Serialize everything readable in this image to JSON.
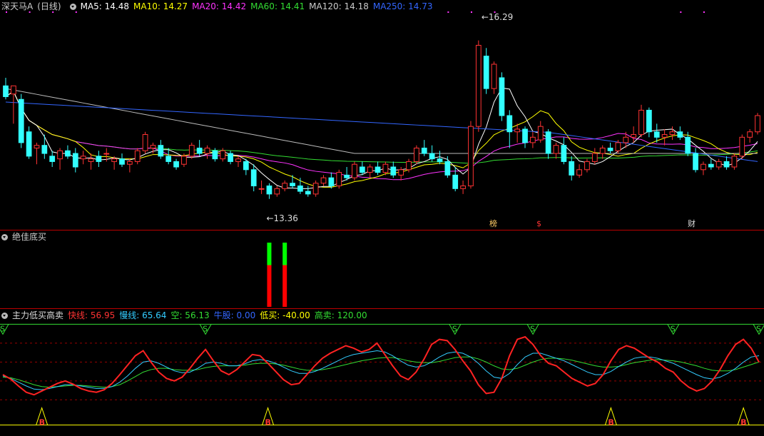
{
  "main_header": {
    "title": "深天马A",
    "period": "(日线)",
    "ma": [
      {
        "label": "MA5:",
        "value": "14.48",
        "color": "#ffffff"
      },
      {
        "label": "MA10:",
        "value": "14.27",
        "color": "#ffff00"
      },
      {
        "label": "MA20:",
        "value": "14.42",
        "color": "#ff33ff"
      },
      {
        "label": "MA60:",
        "value": "14.41",
        "color": "#33dd33"
      },
      {
        "label": "MA120:",
        "value": "14.18",
        "color": "#cccccc"
      },
      {
        "label": "MA250:",
        "value": "14.73",
        "color": "#3366ff"
      }
    ]
  },
  "panel2_header": {
    "title": "绝佳底买"
  },
  "panel3_header": {
    "title": "主力低买高卖",
    "items": [
      {
        "label": "快线:",
        "value": "56.95",
        "color": "#ff3333"
      },
      {
        "label": "慢线:",
        "value": "65.64",
        "color": "#33ccff"
      },
      {
        "label": "空:",
        "value": "56.13",
        "color": "#33dd33"
      },
      {
        "label": "牛股:",
        "value": "0.00",
        "color": "#3366ff"
      },
      {
        "label": "低买:",
        "value": "-40.00",
        "color": "#ffff00"
      },
      {
        "label": "高卖:",
        "value": "120.00",
        "color": "#33dd33"
      }
    ]
  },
  "annotations": {
    "high": "16.29",
    "low": "13.36",
    "tag1": "榜",
    "tag2": "$",
    "tag3": "财"
  },
  "signals": {
    "sell": "S",
    "buy": "B"
  },
  "chart_data": {
    "type": "candlestick",
    "ylim": [
      13.0,
      16.8
    ],
    "candles": [
      [
        15.45,
        15.6,
        15.2,
        15.25
      ],
      [
        15.3,
        15.45,
        14.75,
        15.45
      ],
      [
        15.2,
        15.3,
        14.3,
        14.4
      ],
      [
        14.6,
        14.7,
        14.1,
        14.15
      ],
      [
        14.3,
        14.4,
        14.0,
        14.35
      ],
      [
        14.35,
        14.55,
        14.1,
        14.2
      ],
      [
        14.15,
        14.25,
        13.95,
        14.05
      ],
      [
        14.1,
        14.3,
        13.9,
        14.25
      ],
      [
        14.25,
        14.35,
        14.1,
        14.15
      ],
      [
        14.2,
        14.3,
        13.85,
        13.95
      ],
      [
        14.1,
        14.25,
        14.0,
        14.15
      ],
      [
        14.05,
        14.2,
        13.9,
        14.1
      ],
      [
        14.15,
        14.25,
        13.95,
        14.05
      ],
      [
        14.2,
        14.3,
        14.05,
        14.2
      ],
      [
        14.05,
        14.15,
        13.9,
        14.1
      ],
      [
        14.1,
        14.2,
        13.95,
        14.0
      ],
      [
        14.0,
        14.1,
        13.85,
        14.05
      ],
      [
        14.05,
        14.3,
        14.0,
        14.25
      ],
      [
        14.25,
        14.6,
        14.2,
        14.55
      ],
      [
        14.3,
        14.4,
        14.2,
        14.35
      ],
      [
        14.35,
        14.45,
        14.1,
        14.15
      ],
      [
        14.15,
        14.3,
        14.0,
        14.05
      ],
      [
        14.05,
        14.1,
        13.9,
        13.95
      ],
      [
        14.0,
        14.2,
        13.95,
        14.15
      ],
      [
        14.15,
        14.4,
        14.1,
        14.35
      ],
      [
        14.3,
        14.45,
        14.15,
        14.2
      ],
      [
        14.2,
        14.35,
        14.1,
        14.3
      ],
      [
        14.25,
        14.3,
        14.05,
        14.1
      ],
      [
        14.1,
        14.3,
        14.05,
        14.25
      ],
      [
        14.2,
        14.25,
        14.0,
        14.05
      ],
      [
        14.05,
        14.15,
        13.95,
        14.1
      ],
      [
        14.05,
        14.1,
        13.8,
        13.9
      ],
      [
        13.9,
        14.0,
        13.5,
        13.6
      ],
      [
        13.55,
        13.7,
        13.45,
        13.55
      ],
      [
        13.6,
        13.65,
        13.36,
        13.45
      ],
      [
        13.45,
        13.6,
        13.4,
        13.55
      ],
      [
        13.55,
        13.7,
        13.5,
        13.65
      ],
      [
        13.65,
        13.8,
        13.55,
        13.6
      ],
      [
        13.6,
        13.75,
        13.45,
        13.5
      ],
      [
        13.5,
        13.6,
        13.4,
        13.45
      ],
      [
        13.45,
        13.7,
        13.4,
        13.65
      ],
      [
        13.65,
        13.8,
        13.6,
        13.75
      ],
      [
        13.75,
        13.85,
        13.55,
        13.6
      ],
      [
        13.6,
        13.9,
        13.55,
        13.85
      ],
      [
        13.8,
        13.95,
        13.7,
        13.75
      ],
      [
        13.75,
        14.05,
        13.7,
        14.0
      ],
      [
        13.95,
        14.05,
        13.8,
        13.85
      ],
      [
        13.85,
        14.0,
        13.75,
        13.95
      ],
      [
        13.95,
        14.05,
        13.8,
        13.85
      ],
      [
        13.85,
        14.05,
        13.8,
        14.0
      ],
      [
        13.95,
        14.05,
        13.75,
        13.8
      ],
      [
        13.8,
        13.95,
        13.7,
        13.9
      ],
      [
        13.9,
        14.1,
        13.85,
        14.05
      ],
      [
        14.05,
        14.35,
        14.0,
        14.3
      ],
      [
        14.3,
        14.45,
        14.15,
        14.2
      ],
      [
        14.2,
        14.35,
        14.05,
        14.1
      ],
      [
        14.1,
        14.25,
        14.0,
        14.05
      ],
      [
        14.05,
        14.15,
        13.75,
        13.8
      ],
      [
        13.8,
        13.95,
        13.5,
        13.55
      ],
      [
        13.55,
        13.7,
        13.45,
        13.6
      ],
      [
        13.6,
        14.8,
        13.55,
        14.7
      ],
      [
        14.7,
        16.29,
        14.6,
        16.2
      ],
      [
        16.0,
        16.15,
        15.3,
        15.4
      ],
      [
        15.4,
        15.9,
        15.3,
        15.85
      ],
      [
        15.6,
        15.7,
        14.8,
        14.9
      ],
      [
        14.9,
        15.0,
        14.3,
        14.6
      ],
      [
        14.6,
        14.75,
        14.4,
        14.65
      ],
      [
        14.65,
        14.7,
        14.3,
        14.4
      ],
      [
        14.4,
        14.6,
        14.3,
        14.5
      ],
      [
        14.45,
        14.8,
        14.4,
        14.7
      ],
      [
        14.6,
        14.65,
        14.1,
        14.2
      ],
      [
        14.2,
        14.4,
        14.1,
        14.35
      ],
      [
        14.35,
        14.5,
        14.0,
        14.05
      ],
      [
        14.05,
        14.15,
        13.7,
        13.8
      ],
      [
        13.8,
        14.0,
        13.75,
        13.9
      ],
      [
        13.9,
        14.1,
        13.85,
        14.05
      ],
      [
        14.05,
        14.3,
        14.0,
        14.2
      ],
      [
        14.2,
        14.35,
        14.1,
        14.3
      ],
      [
        14.3,
        14.4,
        14.2,
        14.25
      ],
      [
        14.25,
        14.45,
        14.2,
        14.4
      ],
      [
        14.4,
        14.6,
        14.3,
        14.5
      ],
      [
        14.5,
        14.7,
        14.4,
        14.55
      ],
      [
        14.55,
        15.1,
        14.5,
        15.0
      ],
      [
        15.0,
        15.05,
        14.5,
        14.6
      ],
      [
        14.6,
        14.75,
        14.4,
        14.5
      ],
      [
        14.5,
        14.65,
        14.35,
        14.55
      ],
      [
        14.55,
        14.7,
        14.45,
        14.6
      ],
      [
        14.6,
        14.7,
        14.45,
        14.5
      ],
      [
        14.5,
        14.6,
        14.15,
        14.2
      ],
      [
        14.2,
        14.3,
        13.85,
        13.9
      ],
      [
        13.9,
        14.05,
        13.8,
        14.0
      ],
      [
        14.0,
        14.1,
        13.9,
        13.95
      ],
      [
        13.95,
        14.1,
        13.9,
        14.05
      ],
      [
        14.05,
        14.15,
        13.9,
        13.95
      ],
      [
        13.95,
        14.2,
        13.9,
        14.15
      ],
      [
        14.15,
        14.55,
        14.1,
        14.5
      ],
      [
        14.5,
        14.65,
        14.4,
        14.6
      ],
      [
        14.6,
        14.95,
        14.55,
        14.9
      ]
    ],
    "panel2_bars": [
      {
        "index": 34,
        "green": 0.35,
        "red": 0.65
      },
      {
        "index": 36,
        "green": 0.35,
        "red": 0.65
      }
    ],
    "fast_line": [
      40,
      33,
      22,
      12,
      8,
      14,
      20,
      26,
      30,
      25,
      18,
      14,
      12,
      16,
      26,
      40,
      55,
      70,
      78,
      60,
      44,
      34,
      30,
      36,
      50,
      66,
      80,
      62,
      46,
      40,
      48,
      60,
      72,
      70,
      58,
      45,
      32,
      24,
      26,
      40,
      54,
      66,
      74,
      80,
      86,
      82,
      76,
      80,
      90,
      72,
      54,
      38,
      32,
      44,
      64,
      88,
      96,
      94,
      80,
      62,
      46,
      24,
      10,
      12,
      34,
      70,
      96,
      100,
      88,
      70,
      58,
      54,
      44,
      34,
      28,
      22,
      26,
      40,
      62,
      80,
      86,
      82,
      74,
      66,
      60,
      50,
      44,
      30,
      20,
      14,
      18,
      30,
      48,
      70,
      88,
      96,
      82,
      60
    ],
    "slow_line": [
      38,
      34,
      28,
      22,
      17,
      16,
      18,
      21,
      24,
      24,
      22,
      20,
      18,
      18,
      21,
      28,
      38,
      50,
      60,
      62,
      58,
      52,
      46,
      43,
      44,
      50,
      58,
      60,
      58,
      54,
      54,
      57,
      62,
      64,
      62,
      58,
      52,
      46,
      42,
      42,
      45,
      50,
      56,
      62,
      68,
      72,
      74,
      76,
      78,
      76,
      70,
      62,
      55,
      52,
      54,
      60,
      68,
      74,
      76,
      74,
      68,
      58,
      46,
      36,
      34,
      42,
      56,
      68,
      74,
      74,
      70,
      66,
      62,
      56,
      50,
      44,
      40,
      40,
      45,
      53,
      60,
      66,
      68,
      68,
      66,
      62,
      58,
      52,
      46,
      40,
      35,
      33,
      36,
      42,
      50,
      60,
      68,
      70
    ],
    "kong_line": [
      36,
      35,
      32,
      28,
      24,
      21,
      20,
      21,
      22,
      23,
      23,
      22,
      21,
      20,
      21,
      24,
      30,
      37,
      44,
      48,
      50,
      50,
      48,
      47,
      47,
      48,
      51,
      53,
      54,
      54,
      54,
      55,
      57,
      58,
      58,
      57,
      55,
      52,
      49,
      47,
      47,
      48,
      50,
      53,
      56,
      59,
      62,
      64,
      66,
      67,
      67,
      65,
      62,
      60,
      59,
      59,
      61,
      64,
      67,
      68,
      68,
      65,
      60,
      54,
      49,
      48,
      50,
      55,
      60,
      64,
      66,
      66,
      65,
      63,
      60,
      57,
      54,
      52,
      52,
      53,
      56,
      59,
      61,
      63,
      64,
      63,
      62,
      60,
      57,
      54,
      50,
      47,
      46,
      46,
      48,
      52,
      56,
      60
    ],
    "sell_signals": [
      0,
      26,
      58,
      68,
      86,
      100
    ],
    "buy_signals": [
      5,
      34,
      78,
      95
    ]
  }
}
